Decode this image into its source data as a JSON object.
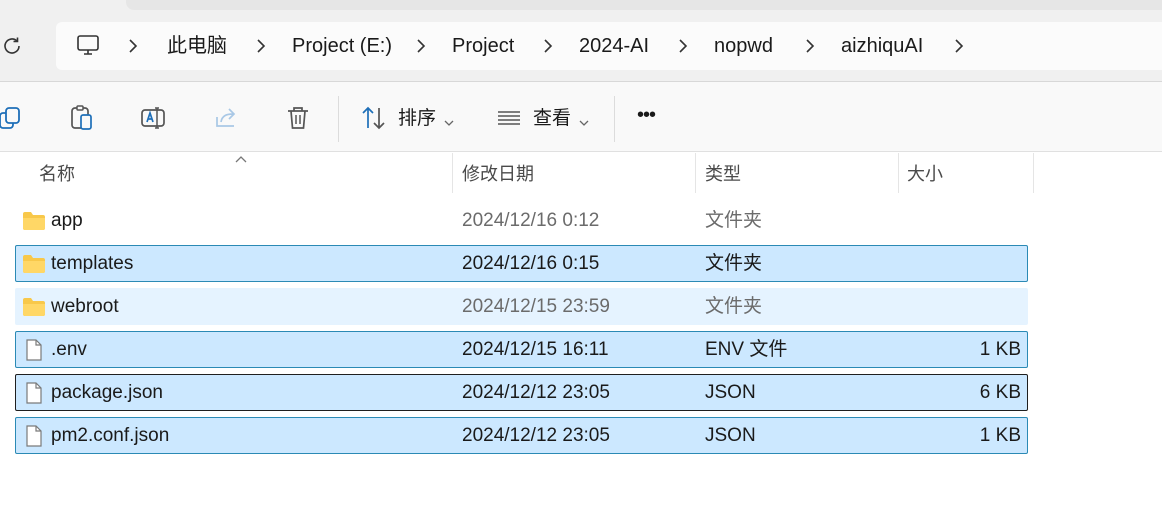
{
  "breadcrumb": {
    "items": [
      "此电脑",
      "Project (E:)",
      "Project",
      "2024-AI",
      "nopwd",
      "aizhiquAI"
    ]
  },
  "toolbar": {
    "sort_label": "排序",
    "view_label": "查看",
    "more_label": "•••"
  },
  "columns": {
    "name": "名称",
    "modified": "修改日期",
    "type": "类型",
    "size": "大小"
  },
  "files": [
    {
      "name": "app",
      "modified": "2024/12/16 0:12",
      "type": "文件夹",
      "size": "",
      "kind": "folder",
      "state": "plain"
    },
    {
      "name": "templates",
      "modified": "2024/12/16 0:15",
      "type": "文件夹",
      "size": "",
      "kind": "folder",
      "state": "selected"
    },
    {
      "name": "webroot",
      "modified": "2024/12/15 23:59",
      "type": "文件夹",
      "size": "",
      "kind": "folder",
      "state": "hover"
    },
    {
      "name": ".env",
      "modified": "2024/12/15 16:11",
      "type": "ENV 文件",
      "size": "1 KB",
      "kind": "file",
      "state": "selected"
    },
    {
      "name": "package.json",
      "modified": "2024/12/12 23:05",
      "type": "JSON",
      "size": "6 KB",
      "kind": "file",
      "state": "selected-focus"
    },
    {
      "name": "pm2.conf.json",
      "modified": "2024/12/12 23:05",
      "type": "JSON",
      "size": "1 KB",
      "kind": "file",
      "state": "selected"
    }
  ],
  "colors": {
    "selection": "#cce8ff",
    "selection_border": "#2b8ab5",
    "hover": "#e5f3ff",
    "folder": "#f8c84a"
  }
}
